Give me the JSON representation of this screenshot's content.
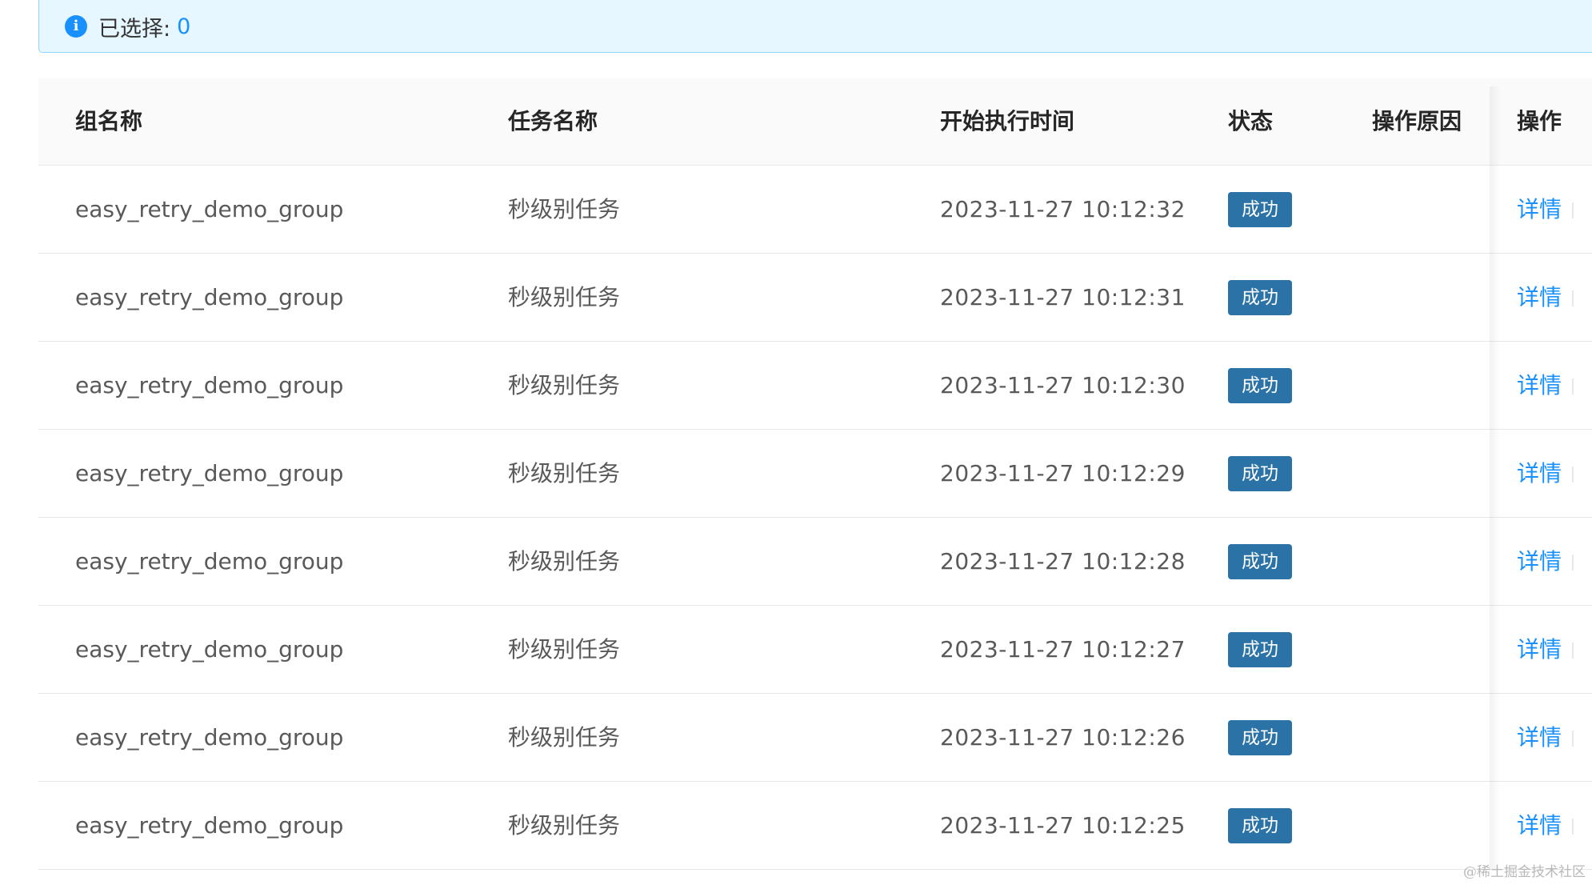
{
  "selection": {
    "label": "已选择:",
    "count": "0"
  },
  "table": {
    "columns": {
      "group": "组名称",
      "task": "任务名称",
      "time": "开始执行时间",
      "status": "状态",
      "reason": "操作原因",
      "op": "操作"
    },
    "rows": [
      {
        "group": "easy_retry_demo_group",
        "task": "秒级别任务",
        "time": "2023-11-27 10:12:32",
        "status": "成功",
        "reason": "",
        "action": "详情"
      },
      {
        "group": "easy_retry_demo_group",
        "task": "秒级别任务",
        "time": "2023-11-27 10:12:31",
        "status": "成功",
        "reason": "",
        "action": "详情"
      },
      {
        "group": "easy_retry_demo_group",
        "task": "秒级别任务",
        "time": "2023-11-27 10:12:30",
        "status": "成功",
        "reason": "",
        "action": "详情"
      },
      {
        "group": "easy_retry_demo_group",
        "task": "秒级别任务",
        "time": "2023-11-27 10:12:29",
        "status": "成功",
        "reason": "",
        "action": "详情"
      },
      {
        "group": "easy_retry_demo_group",
        "task": "秒级别任务",
        "time": "2023-11-27 10:12:28",
        "status": "成功",
        "reason": "",
        "action": "详情"
      },
      {
        "group": "easy_retry_demo_group",
        "task": "秒级别任务",
        "time": "2023-11-27 10:12:27",
        "status": "成功",
        "reason": "",
        "action": "详情"
      },
      {
        "group": "easy_retry_demo_group",
        "task": "秒级别任务",
        "time": "2023-11-27 10:12:26",
        "status": "成功",
        "reason": "",
        "action": "详情"
      },
      {
        "group": "easy_retry_demo_group",
        "task": "秒级别任务",
        "time": "2023-11-27 10:12:25",
        "status": "成功",
        "reason": "",
        "action": "详情"
      }
    ]
  },
  "icons": {
    "alert": "info-icon"
  },
  "colors": {
    "accent": "#1890ff",
    "status_success": "#2b72a6",
    "alert_bg": "#e6f7ff"
  },
  "watermark": "@稀土掘金技术社区"
}
